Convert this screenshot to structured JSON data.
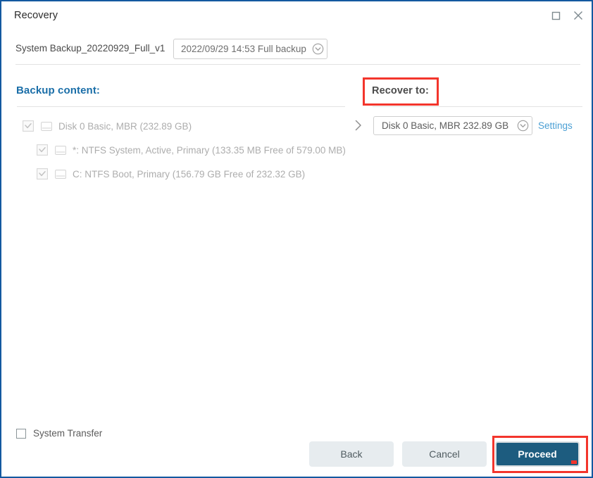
{
  "window": {
    "title": "Recovery",
    "border_color": "#1359a0",
    "controls": [
      {
        "name": "maximize",
        "icon": "maximize-icon"
      },
      {
        "name": "close",
        "icon": "close-icon"
      }
    ]
  },
  "header": {
    "backup_name": "System Backup_20220929_Full_v1",
    "version_dropdown": {
      "value": "2022/09/29 14:53 Full backup",
      "icon": "chevron-down-circle-icon"
    }
  },
  "left_panel": {
    "heading": "Backup content:",
    "heading_color": "#1a6ea8",
    "tree": [
      {
        "label": "Disk 0 Basic, MBR (232.89 GB)",
        "checked": true,
        "disabled": true,
        "indent": 0,
        "icon": "disk-icon"
      },
      {
        "label": "*: NTFS System, Active, Primary (133.35 MB Free of 579.00 MB)",
        "checked": true,
        "disabled": true,
        "indent": 1,
        "icon": "disk-icon"
      },
      {
        "label": "C: NTFS Boot, Primary (156.79 GB Free of 232.32 GB)",
        "checked": true,
        "disabled": true,
        "indent": 1,
        "icon": "disk-icon"
      }
    ]
  },
  "right_panel": {
    "heading": "Recover to:",
    "arrow_icon": "chevron-right-icon",
    "target_dropdown": {
      "value": "Disk 0 Basic, MBR 232.89 GB",
      "icon": "chevron-down-circle-icon"
    },
    "settings_link": "Settings",
    "settings_link_color": "#4a9fd4"
  },
  "footer": {
    "system_transfer": {
      "label": "System Transfer",
      "checked": false
    },
    "buttons": {
      "back": "Back",
      "cancel": "Cancel",
      "proceed": "Proceed"
    },
    "proceed_color": "#1d5c7f"
  },
  "annotations": {
    "color": "#f3352c",
    "boxes": [
      {
        "target": "recover-to-heading"
      },
      {
        "target": "proceed-button"
      }
    ]
  }
}
